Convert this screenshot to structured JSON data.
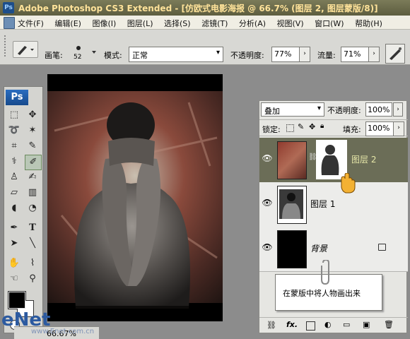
{
  "title_bar": {
    "app_icon": "Ps",
    "title": "Adobe Photoshop CS3 Extended - [仿欧式电影海报 @ 66.7% (图层 2, 图层蒙版/8)]"
  },
  "menu": {
    "items": [
      "文件(F)",
      "编辑(E)",
      "图像(I)",
      "图层(L)",
      "选择(S)",
      "滤镜(T)",
      "分析(A)",
      "视图(V)",
      "窗口(W)",
      "帮助(H)"
    ]
  },
  "options_bar": {
    "brush_label": "画笔:",
    "brush_size": "52",
    "mode_label": "模式:",
    "mode_value": "正常",
    "opacity_label": "不透明度:",
    "opacity_value": "77%",
    "flow_label": "流量:",
    "flow_value": "71%"
  },
  "toolbox": {
    "logo": "Ps"
  },
  "layers_panel": {
    "blend_mode": "叠加",
    "opacity_label": "不透明度:",
    "opacity_value": "100%",
    "lock_label": "锁定:",
    "fill_label": "填充:",
    "fill_value": "100%",
    "layers": [
      {
        "name": "图层 2",
        "selected": true,
        "has_mask": true
      },
      {
        "name": "图层 1",
        "selected": false,
        "has_mask": false
      },
      {
        "name": "背景",
        "selected": false,
        "locked": true
      }
    ],
    "callout": "在蒙版中将人物画出来"
  },
  "status": {
    "zoom": "66.67%"
  },
  "watermark": {
    "text": "eNet",
    "sub": "www.Enet.com.cn"
  },
  "colors": {
    "title_bg": "#6a6a4b",
    "title_text": "#ffe39a",
    "selected_layer": "#6b6d57",
    "panel_bg": "#e6e6e2"
  }
}
